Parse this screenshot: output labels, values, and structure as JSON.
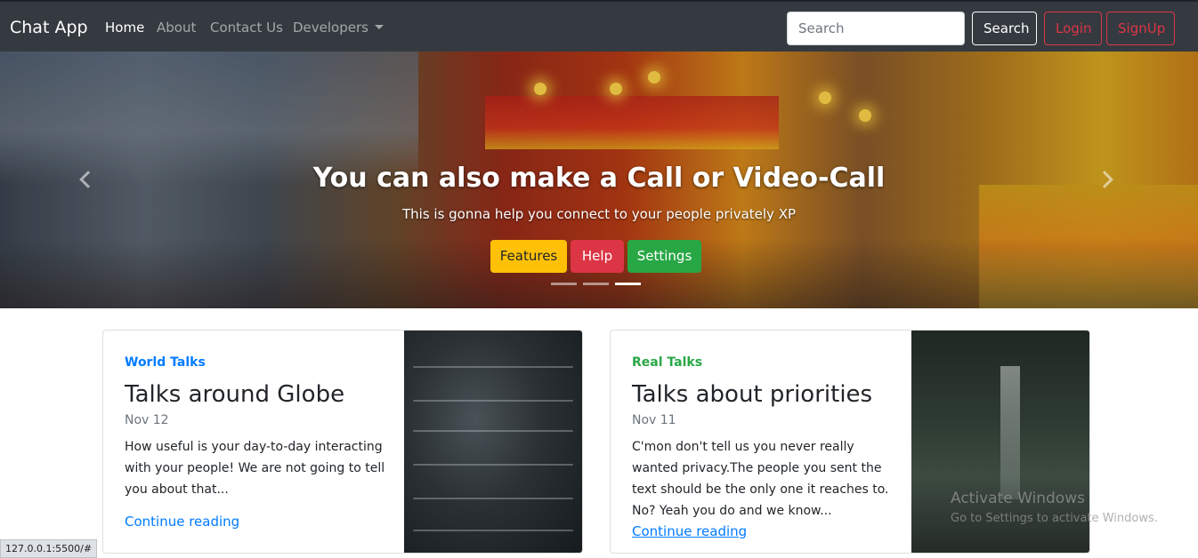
{
  "navbar": {
    "brand": "Chat App",
    "links": [
      {
        "label": "Home"
      },
      {
        "label": "About"
      },
      {
        "label": "Contact Us"
      },
      {
        "label": "Developers"
      }
    ],
    "search_placeholder": "Search",
    "search_button": "Search",
    "login_button": "Login",
    "signup_button": "SignUp"
  },
  "carousel": {
    "title": "You can also make a Call or Video-Call",
    "subtitle": "This is gonna help you connect to your people privately XP",
    "buttons": [
      {
        "label": "Features",
        "color": "#ffc107"
      },
      {
        "label": "Help",
        "color": "#dc3545"
      },
      {
        "label": "Settings",
        "color": "#28a745"
      }
    ],
    "slide_count": 3,
    "active_slide": 3
  },
  "cards": [
    {
      "category": "World Talks",
      "category_color": "#007bff",
      "title": "Talks around Globe",
      "date": "Nov 12",
      "text": "How useful is your day-to-day interacting with your people! We are not going to tell you about that...",
      "link": "Continue reading"
    },
    {
      "category": "Real Talks",
      "category_color": "#28a745",
      "title": "Talks about priorities",
      "date": "Nov 11",
      "text": "C'mon don't tell us you never really wanted privacy.The people you sent the text should be the only one it reaches to. No? Yeah you do and we know...",
      "link": "Continue reading"
    }
  ],
  "status_url": "127.0.0.1:5500/#",
  "watermark": {
    "title": "Activate Windows",
    "subtitle": "Go to Settings to activate Windows."
  }
}
